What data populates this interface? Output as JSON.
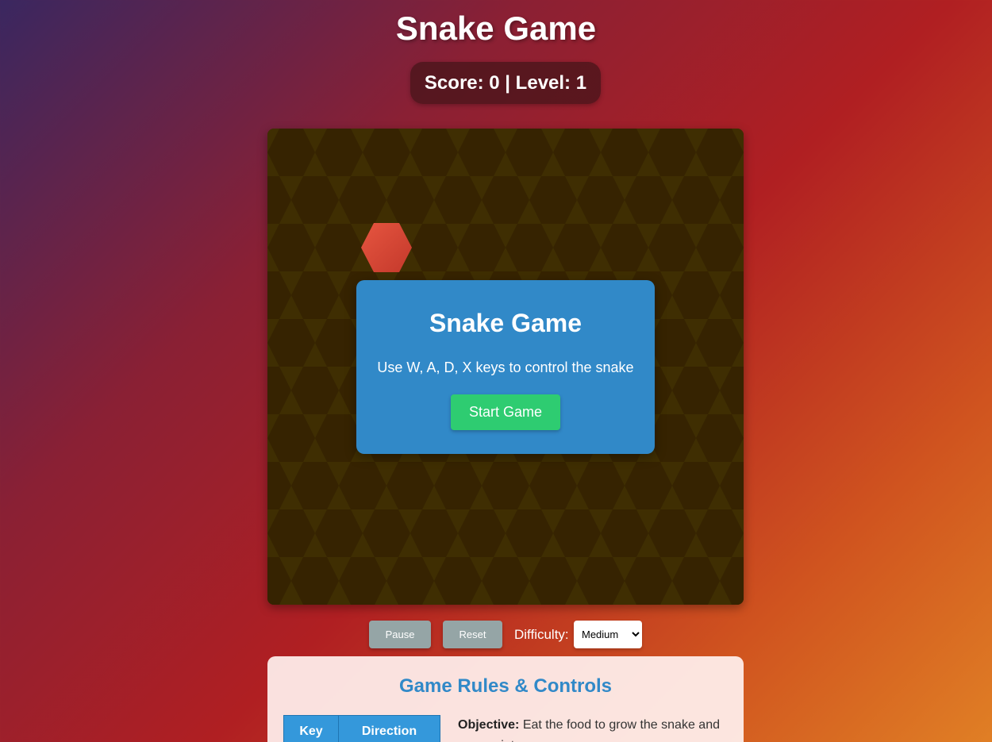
{
  "header": {
    "title": "Snake Game",
    "score_text": "Score: 0 | Level: 1"
  },
  "board": {
    "background_color": "#3f2e02",
    "hex_color": "#301d02",
    "food_color": "#d9432f",
    "food_icon": "hexagon-food-icon"
  },
  "start_modal": {
    "title": "Snake Game",
    "instructions": "Use W, A, D, X keys to control the snake",
    "start_button": "Start Game",
    "background_color": "#3189c8"
  },
  "controls": {
    "pause_button": "Pause",
    "reset_button": "Reset",
    "difficulty_label": "Difficulty:",
    "difficulty_selected": "Medium"
  },
  "rules": {
    "title": "Game Rules & Controls",
    "table_headers": [
      "Key",
      "Direction"
    ],
    "objective_label": "Objective:",
    "objective_text": "Eat the food to grow the snake and earn points."
  }
}
